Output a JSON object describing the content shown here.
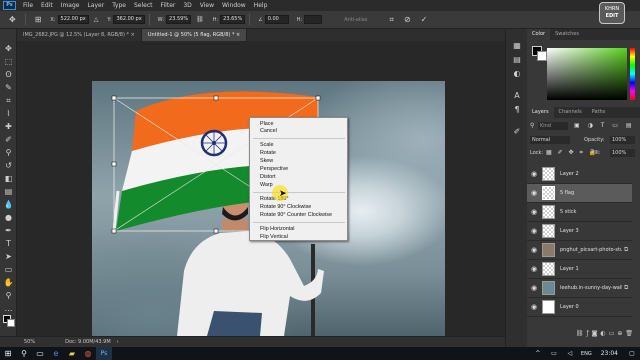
{
  "menu": [
    "File",
    "Edit",
    "Image",
    "Layer",
    "Type",
    "Select",
    "Filter",
    "3D",
    "View",
    "Window",
    "Help"
  ],
  "app_logo": "Ps",
  "options": {
    "x_label": "X:",
    "x_value": "522.00 px",
    "y_label": "Y:",
    "y_value": "362.00 px",
    "w_label": "W:",
    "w_value": "23.59%",
    "h_label": "H:",
    "h_value": "23.65%",
    "angle_label": "∠",
    "angle_value": "0.00",
    "interp_label": "Anti-alias"
  },
  "tabs": [
    {
      "label": "IMG_2682.JPG @ 12.5% (Layer 8, RGB/8) *",
      "active": false
    },
    {
      "label": "Untitled-1 @ 50% (5 flag, RGB/8) *",
      "active": true
    }
  ],
  "context_menu": {
    "group1": [
      "Place",
      "Cancel"
    ],
    "group2": [
      "Scale",
      "Rotate",
      "Skew",
      "Perspective",
      "Distort",
      "Warp"
    ],
    "group3": [
      "Rotate 180°",
      "Rotate 90° Clockwise",
      "Rotate 90° Counter Clockwise"
    ],
    "group4": [
      "Flip Horizontal",
      "Flip Vertical"
    ]
  },
  "status": {
    "zoom": "50%",
    "doc": "Doc: 9.00M/43.9M"
  },
  "color_panel": {
    "tabs": [
      "Color",
      "Swatches"
    ]
  },
  "layers_panel": {
    "tabs": [
      "Layers",
      "Channels",
      "Paths"
    ],
    "kind_placeholder": "Kind",
    "blend_mode": "Normal",
    "opacity_label": "Opacity:",
    "opacity_value": "100%",
    "lock_label": "Lock:",
    "fill_label": "Fill:",
    "fill_value": "100%",
    "layers": [
      {
        "name": "Layer 2",
        "selected": false
      },
      {
        "name": "5 flag",
        "selected": true
      },
      {
        "name": "5 stick",
        "selected": false
      },
      {
        "name": "Layer 3",
        "selected": false
      },
      {
        "name": "pnghut_picsart-photo-stu...",
        "selected": false
      },
      {
        "name": "Layer 1",
        "selected": false
      },
      {
        "name": "leehub.in-sunny-day-wall...",
        "selected": false
      },
      {
        "name": "Layer 0",
        "selected": false
      }
    ]
  },
  "watermark": {
    "line1": "KHRN",
    "line2": "EDIT"
  },
  "taskbar": {
    "time": "23:04",
    "lang": "ENG"
  },
  "colors": {
    "accent": "#1473e6",
    "flag_saffron": "#f26a1b",
    "flag_green": "#138a2c",
    "chakra": "#1f2f7a"
  }
}
